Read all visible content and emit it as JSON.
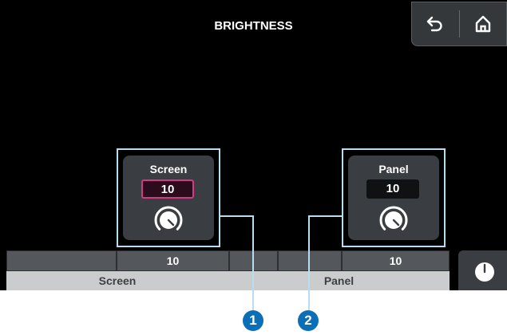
{
  "title": "BRIGHTNESS",
  "nav": {
    "back_icon": "back-arrow-icon",
    "home_icon": "home-icon"
  },
  "knobs": [
    {
      "label": "Screen",
      "value": "10",
      "selected": true
    },
    {
      "label": "Panel",
      "value": "10",
      "selected": false
    }
  ],
  "strip": {
    "values": [
      "",
      "10",
      "",
      "",
      "10",
      ""
    ],
    "labels": [
      "Screen",
      "Panel"
    ]
  },
  "side_button_icon": "clock-icon",
  "callouts": [
    "1",
    "2"
  ],
  "colors": {
    "accent": "#d33a86",
    "highlight": "#b9dcf0",
    "callout": "#0a6fb7"
  }
}
